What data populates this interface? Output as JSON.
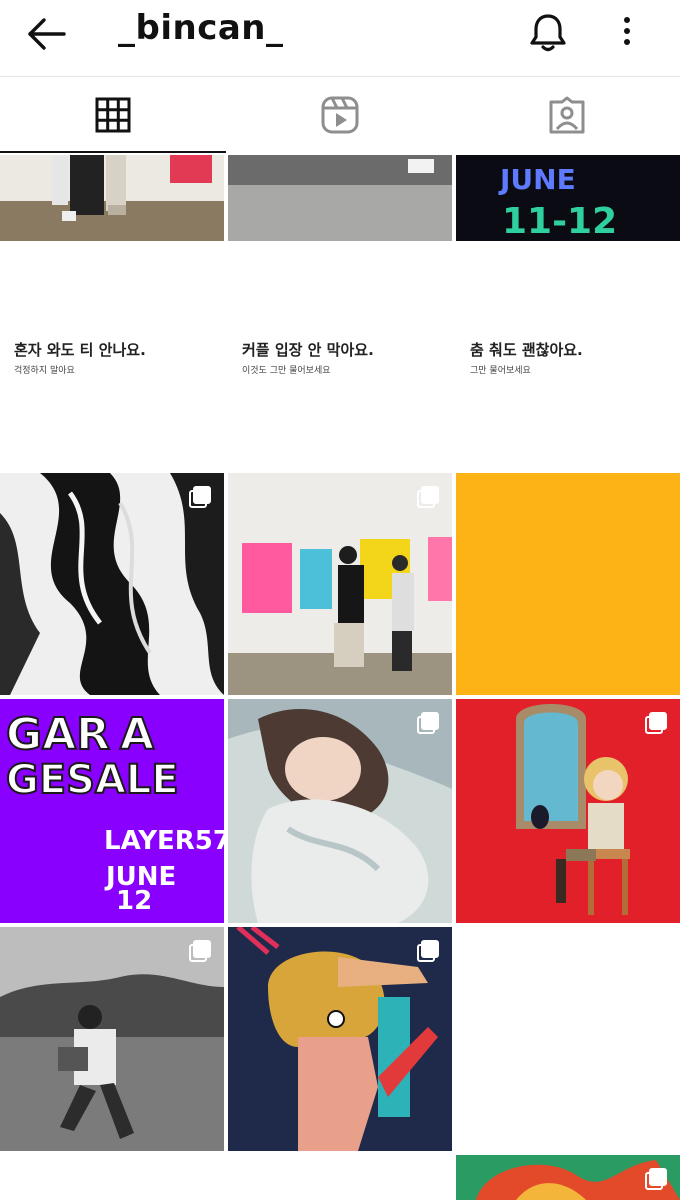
{
  "header": {
    "back_icon": "arrow-left-icon",
    "username": "_bincan_",
    "bell_icon": "bell-icon",
    "more_icon": "more-vertical-icon"
  },
  "tabs": [
    {
      "name": "grid",
      "icon": "grid-icon",
      "active": true
    },
    {
      "name": "reels",
      "icon": "reels-icon",
      "active": false
    },
    {
      "name": "tagged",
      "icon": "tagged-person-icon",
      "active": false
    }
  ],
  "posts_row2": [
    {
      "title": "혼자 와도 티 안나요.",
      "subtitle": "걱정하지 말아요"
    },
    {
      "title": "커플 입장 안 막아요.",
      "subtitle": "이것도 그만 물어보세요"
    },
    {
      "title": "춤 춰도 괜찮아요.",
      "subtitle": "그만 물어보세요"
    }
  ],
  "colors": {
    "orange_tile": "#FDB316",
    "purple_tile": "#8A00FF",
    "red_tile": "#E2202A",
    "navy_tile": "#1F2A4A",
    "divider": "#E6E6E6"
  }
}
